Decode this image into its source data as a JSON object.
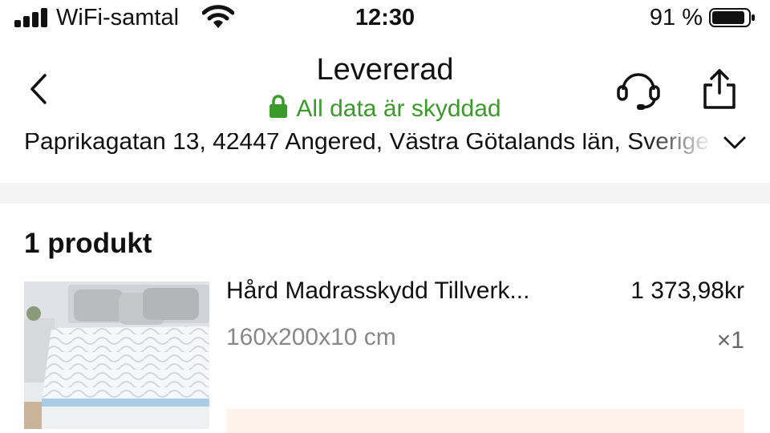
{
  "status_bar": {
    "carrier": "WiFi-samtal",
    "time": "12:30",
    "battery_percent": "91 %",
    "battery_level": 0.91
  },
  "header": {
    "title": "Levererad",
    "secure_text": "All data är skyddad",
    "accent_green": "#3a9a2a"
  },
  "address": {
    "text": "Paprikagatan 13, 42447 Angered, Västra Götalands län, Sverige"
  },
  "products": {
    "count_label": "1 produkt",
    "items": [
      {
        "name": "Hård Madrasskydd Tillverk...",
        "price": "1 373,98kr",
        "variant": "160x200x10 cm",
        "quantity": "×1"
      }
    ]
  },
  "icons": {
    "back": "chevron-left-icon",
    "lock": "lock-icon",
    "support": "headset-icon",
    "share": "share-icon",
    "expand": "chevron-down-icon"
  }
}
